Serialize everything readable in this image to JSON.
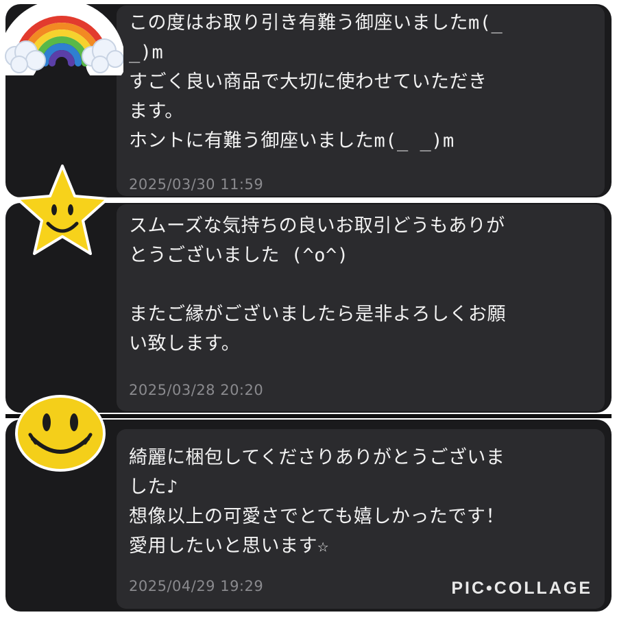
{
  "reviews": [
    {
      "text": "この度はお取り引き有難う御座いましたm(_\n_)m\nすごく良い商品で大切に使わせていただき\nます。\nホントに有難う御座いましたm(_ _)m",
      "timestamp": "2025/03/30 11:59",
      "sticker": "rainbow-icon"
    },
    {
      "text": "スムーズな気持ちの良いお取引どうもありが\nとうございました (^o^)\n\nまたご縁がございましたら是非よろしくお願\nい致します。",
      "timestamp": "2025/03/28 20:20",
      "sticker": "smiling-star-icon"
    },
    {
      "text": "綺麗に梱包してくださりありがとうございま\nした♪\n想像以上の可愛さでとても嬉しかったです！\n愛用したいと思います☆",
      "timestamp": "2025/04/29 19:29",
      "sticker": "smiley-face-icon"
    }
  ],
  "watermark": "PIC•COLLAGE",
  "colors": {
    "panel": "#1a1a1c",
    "card": "#2b2b2e",
    "text": "#f2f2f2",
    "timestamp": "#8a8a8e",
    "star": "#f7d21b",
    "smiley": "#f4cf1a"
  }
}
